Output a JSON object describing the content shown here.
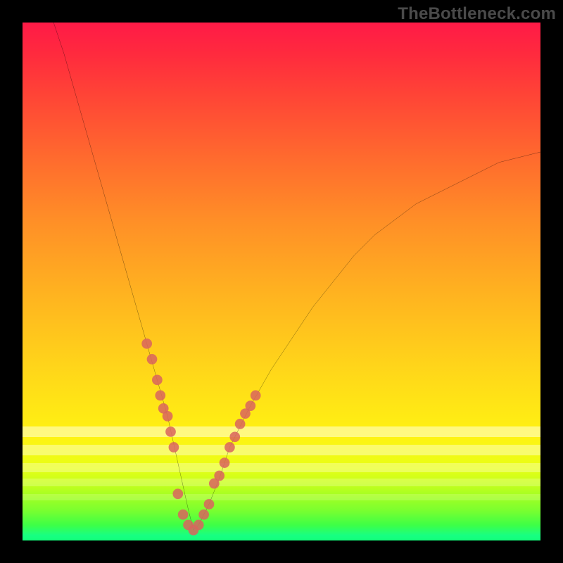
{
  "watermark": "TheBottleneck.com",
  "colors": {
    "frame": "#000000",
    "curve": "#000000",
    "marker": "#d9645e",
    "marker_stroke": "#d9645e"
  },
  "chart_data": {
    "type": "line",
    "title": "",
    "xlabel": "",
    "ylabel": "",
    "xlim": [
      0,
      100
    ],
    "ylim": [
      0,
      100
    ],
    "grid": false,
    "legend": false,
    "notes": "V-shaped bottleneck curve on a red→green vertical gradient. Minimum near x≈33 at y≈2. Pale yellow horizontal bands appear from roughly y=12 to y=22. Dull-red marker dots highlight two clusters on the curve flanks and the valley.",
    "series": [
      {
        "name": "bottleneck-curve",
        "x": [
          6,
          8,
          10,
          12,
          14,
          16,
          18,
          20,
          22,
          24,
          26,
          28,
          30,
          32,
          33,
          34,
          36,
          38,
          40,
          44,
          48,
          52,
          56,
          60,
          64,
          68,
          72,
          76,
          80,
          84,
          88,
          92,
          96,
          100
        ],
        "y": [
          100,
          94,
          87,
          80,
          73,
          66,
          59,
          52,
          45,
          38,
          31,
          24,
          15,
          6,
          2,
          3,
          7,
          12,
          18,
          26,
          33,
          39,
          45,
          50,
          55,
          59,
          62,
          65,
          67,
          69,
          71,
          73,
          74,
          75
        ]
      }
    ],
    "markers": [
      {
        "name": "left-cluster",
        "x": [
          24,
          25,
          26,
          26.6,
          27.2,
          28,
          28.6,
          29.2
        ],
        "y": [
          38,
          35,
          31,
          28,
          25.5,
          24,
          21,
          18
        ]
      },
      {
        "name": "valley",
        "x": [
          30,
          31,
          32,
          33,
          34,
          35,
          36
        ],
        "y": [
          9,
          5,
          3,
          2,
          3,
          5,
          7
        ]
      },
      {
        "name": "right-cluster",
        "x": [
          37,
          38,
          39,
          40,
          41,
          42,
          43,
          44,
          45
        ],
        "y": [
          11,
          12.5,
          15,
          18,
          20,
          22.5,
          24.5,
          26,
          28
        ]
      }
    ],
    "bands_y": [
      22,
      18.5,
      15,
      12,
      9
    ]
  }
}
